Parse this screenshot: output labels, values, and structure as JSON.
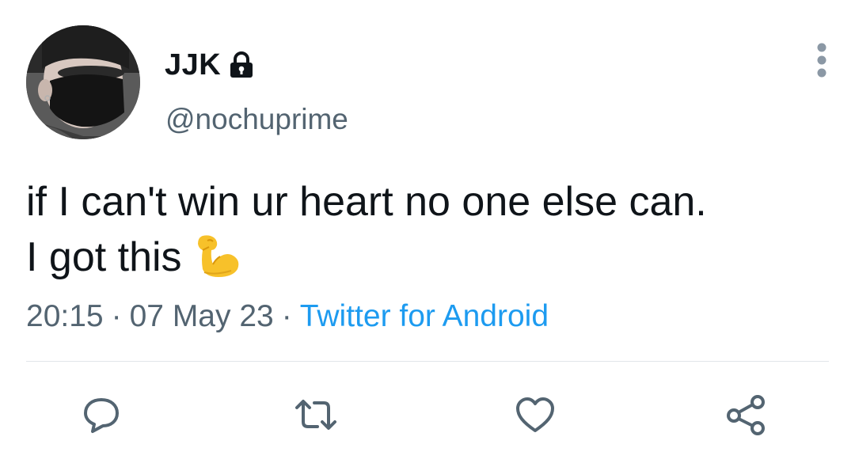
{
  "user": {
    "display_name": "JJK",
    "handle": "@nochuprime",
    "protected_icon": "lock-icon",
    "avatar": "avatar-image"
  },
  "tweet": {
    "text_line_1": "if I can't win ur heart no one else can.",
    "text_line_2": "I got this",
    "emoji": "flexed-biceps-emoji"
  },
  "meta": {
    "time": "20:15",
    "date": "07 May 23",
    "separator": "·",
    "source": "Twitter for Android"
  },
  "actions": {
    "reply_icon": "reply-icon",
    "retweet_icon": "retweet-icon",
    "like_icon": "heart-icon",
    "share_icon": "share-icon"
  },
  "colors": {
    "text": "#0f1419",
    "secondary": "#536471",
    "link": "#1d9bf0",
    "divider": "#e1e6ea"
  }
}
